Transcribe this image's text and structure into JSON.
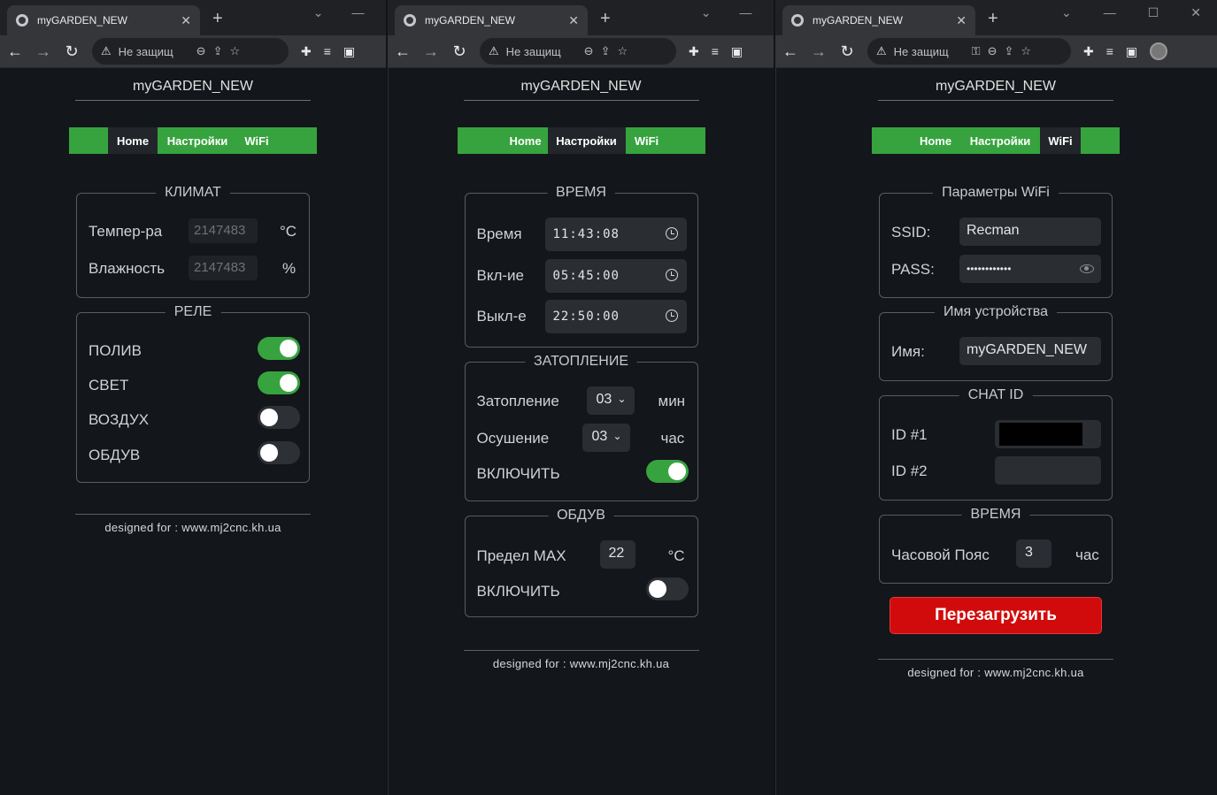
{
  "browser": {
    "tab_title": "myGARDEN_NEW",
    "security_text": "Не защищ",
    "close_glyph": "✕",
    "newtab_glyph": "+",
    "controls": {
      "chevron": "⌄",
      "minimize": "—",
      "maximize": "☐",
      "close": "✕"
    }
  },
  "app": {
    "title": "myGARDEN_NEW",
    "nav": [
      "Home",
      "Настройки",
      "WiFi"
    ],
    "footer": "designed for : www.mj2cnc.kh.ua"
  },
  "home": {
    "climate": {
      "legend": "КЛИМАТ",
      "temp_label": "Темпер-ра",
      "temp_value": "2147483",
      "temp_unit": "°C",
      "hum_label": "Влажность",
      "hum_value": "2147483",
      "hum_unit": "%"
    },
    "relay": {
      "legend": "РЕЛЕ",
      "items": [
        {
          "label": "ПОЛИВ",
          "on": true
        },
        {
          "label": "СВЕТ",
          "on": true
        },
        {
          "label": "ВОЗДУХ",
          "on": false
        },
        {
          "label": "ОБДУВ",
          "on": false
        }
      ]
    }
  },
  "settings": {
    "time": {
      "legend": "ВРЕМЯ",
      "rows": [
        {
          "label": "Время",
          "value": "11:43:08"
        },
        {
          "label": "Вкл-ие",
          "value": "05:45:00"
        },
        {
          "label": "Выкл-е",
          "value": "22:50:00"
        }
      ]
    },
    "flood": {
      "legend": "ЗАТОПЛЕНИЕ",
      "flood_label": "Затопление",
      "flood_value": "03",
      "flood_unit": "мин",
      "dry_label": "Осушение",
      "dry_value": "03",
      "dry_unit": "час",
      "enable_label": "ВКЛЮЧИТЬ",
      "enabled": true
    },
    "blow": {
      "legend": "ОБДУВ",
      "max_label": "Предел MAX",
      "max_value": "22",
      "max_unit": "°C",
      "enable_label": "ВКЛЮЧИТЬ",
      "enabled": false
    }
  },
  "wifi": {
    "params": {
      "legend": "Параметры WiFi",
      "ssid_label": "SSID:",
      "ssid_value": "Recman",
      "pass_label": "PASS:",
      "pass_value": "••••••••••••"
    },
    "device": {
      "legend": "Имя устройства",
      "name_label": "Имя:",
      "name_value": "myGARDEN_NEW"
    },
    "chat": {
      "legend": "CHAT ID",
      "id1_label": "ID #1",
      "id2_label": "ID #2"
    },
    "time": {
      "legend": "ВРЕМЯ",
      "tz_label": "Часовой Пояс",
      "tz_value": "3",
      "tz_unit": "час"
    },
    "reboot_label": "Перезагрузить"
  },
  "colors": {
    "accent_green": "#37a33f",
    "reboot_red": "#d10b0b",
    "background": "#13161a"
  }
}
